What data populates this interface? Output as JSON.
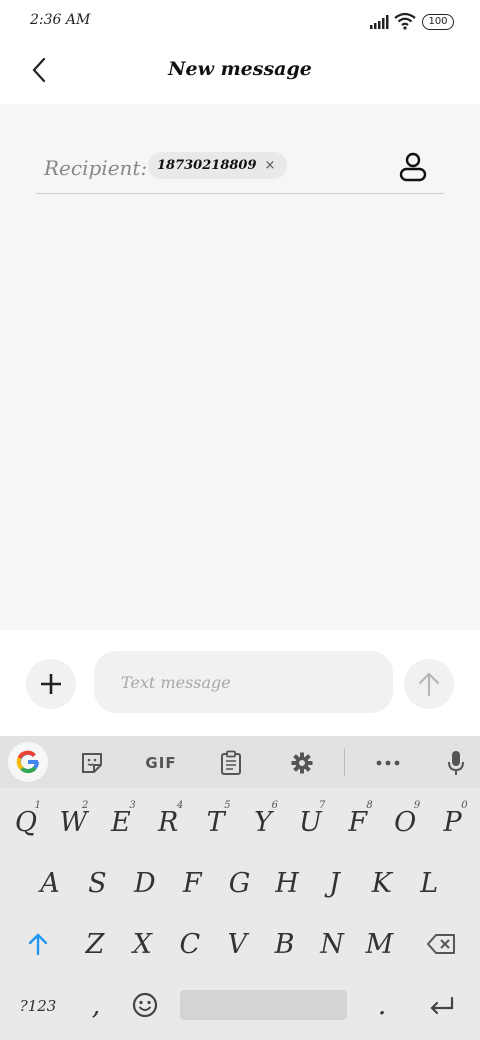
{
  "status_bar": {
    "time": "2:36 AM",
    "battery": "100",
    "signal_icon": "signal-icon",
    "wifi_icon": "wifi-icon"
  },
  "header": {
    "title": "New message",
    "back_icon": "chevron-left-icon"
  },
  "recipient": {
    "label": "Recipient:",
    "chip_number": "18730218809",
    "chip_remove": "×",
    "contact_icon": "person-icon"
  },
  "compose": {
    "placeholder": "Text message",
    "value": "",
    "attach_icon": "plus-icon",
    "send_icon": "arrow-up-icon"
  },
  "keyboard": {
    "toolbar": {
      "gif_label": "GIF",
      "icons": [
        "google-icon",
        "sticker-icon",
        "clipboard-icon",
        "gear-icon",
        "more-icon",
        "mic-icon"
      ]
    },
    "row1": [
      {
        "label": "Q",
        "hint": "1"
      },
      {
        "label": "W",
        "hint": "2"
      },
      {
        "label": "E",
        "hint": "3"
      },
      {
        "label": "R",
        "hint": "4"
      },
      {
        "label": "T",
        "hint": "5"
      },
      {
        "label": "Y",
        "hint": "6"
      },
      {
        "label": "U",
        "hint": "7"
      },
      {
        "label": "F",
        "hint": "8"
      },
      {
        "label": "O",
        "hint": "9"
      },
      {
        "label": "P",
        "hint": "0"
      }
    ],
    "row2": [
      "A",
      "S",
      "D",
      "F",
      "G",
      "H",
      "J",
      "K",
      "L"
    ],
    "row3": [
      "Z",
      "X",
      "C",
      "V",
      "B",
      "N",
      "M"
    ],
    "bottom": {
      "symbols_label": "?123",
      "comma": ",",
      "period": "."
    }
  },
  "colors": {
    "content_bg": "#f6f6f6",
    "keyboard_bg": "#e9e9e9",
    "accent_blue": "#2196f3"
  }
}
